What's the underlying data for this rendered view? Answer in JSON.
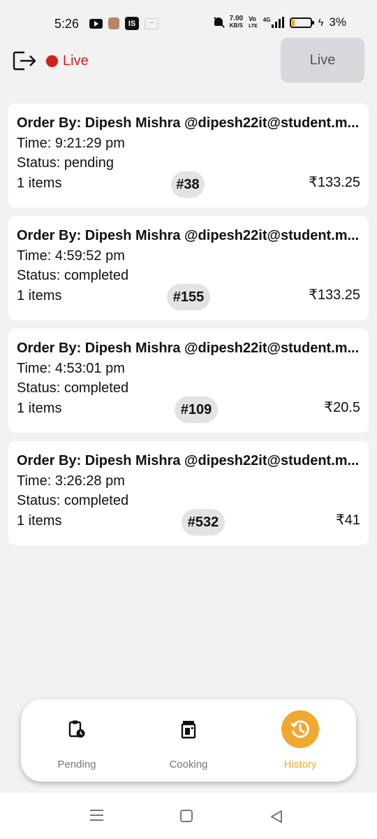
{
  "status_bar": {
    "time": "5:26",
    "is_label": "IS",
    "speed_value": "7.00",
    "speed_unit": "KB/S",
    "volte_top": "Vo",
    "volte_bottom": "LTE",
    "network": "4G",
    "battery_percent": "3%"
  },
  "header": {
    "live_status": "Live",
    "live_button": "Live",
    "live_color": "#d11f1f"
  },
  "orders": [
    {
      "order_by": "Order By: Dipesh Mishra  @dipesh22it@student.m...",
      "time": "Time: 9:21:29 pm",
      "status": "Status: pending",
      "items": "1 items",
      "number": "#38",
      "price": "₹133.25"
    },
    {
      "order_by": "Order By: Dipesh Mishra  @dipesh22it@student.m...",
      "time": "Time: 4:59:52 pm",
      "status": "Status: completed",
      "items": "1 items",
      "number": "#155",
      "price": "₹133.25"
    },
    {
      "order_by": "Order By: Dipesh Mishra  @dipesh22it@student.m...",
      "time": "Time: 4:53:01 pm",
      "status": "Status: completed",
      "items": "1 items",
      "number": "#109",
      "price": "₹20.5"
    },
    {
      "order_by": "Order By: Dipesh Mishra  @dipesh22it@student.m...",
      "time": "Time: 3:26:28 pm",
      "status": "Status: completed",
      "items": "1 items",
      "number": "#532",
      "price": "₹41"
    }
  ],
  "bottom_nav": {
    "items": [
      {
        "label": "Pending",
        "icon": "clipboard-clock-icon",
        "active": false
      },
      {
        "label": "Cooking",
        "icon": "cooker-icon",
        "active": false
      },
      {
        "label": "History",
        "icon": "history-icon",
        "active": true
      }
    ],
    "active_color": "#f0a830"
  }
}
